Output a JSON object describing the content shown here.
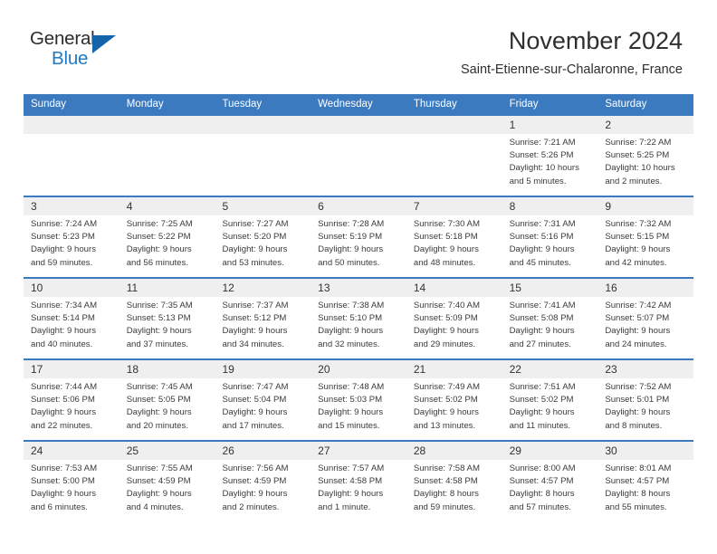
{
  "brand": {
    "name_part1": "General",
    "name_part2": "Blue",
    "logo_icon": "triangle-logo-icon",
    "accent_color": "#1f7ac4",
    "header_color": "#3c7ac0"
  },
  "header": {
    "title": "November 2024",
    "subtitle": "Saint-Etienne-sur-Chalaronne, France"
  },
  "calendar": {
    "weekdays": [
      "Sunday",
      "Monday",
      "Tuesday",
      "Wednesday",
      "Thursday",
      "Friday",
      "Saturday"
    ],
    "weeks": [
      [
        {
          "day": "",
          "lines": []
        },
        {
          "day": "",
          "lines": []
        },
        {
          "day": "",
          "lines": []
        },
        {
          "day": "",
          "lines": []
        },
        {
          "day": "",
          "lines": []
        },
        {
          "day": "1",
          "lines": [
            "Sunrise: 7:21 AM",
            "Sunset: 5:26 PM",
            "Daylight: 10 hours",
            "and 5 minutes."
          ]
        },
        {
          "day": "2",
          "lines": [
            "Sunrise: 7:22 AM",
            "Sunset: 5:25 PM",
            "Daylight: 10 hours",
            "and 2 minutes."
          ]
        }
      ],
      [
        {
          "day": "3",
          "lines": [
            "Sunrise: 7:24 AM",
            "Sunset: 5:23 PM",
            "Daylight: 9 hours",
            "and 59 minutes."
          ]
        },
        {
          "day": "4",
          "lines": [
            "Sunrise: 7:25 AM",
            "Sunset: 5:22 PM",
            "Daylight: 9 hours",
            "and 56 minutes."
          ]
        },
        {
          "day": "5",
          "lines": [
            "Sunrise: 7:27 AM",
            "Sunset: 5:20 PM",
            "Daylight: 9 hours",
            "and 53 minutes."
          ]
        },
        {
          "day": "6",
          "lines": [
            "Sunrise: 7:28 AM",
            "Sunset: 5:19 PM",
            "Daylight: 9 hours",
            "and 50 minutes."
          ]
        },
        {
          "day": "7",
          "lines": [
            "Sunrise: 7:30 AM",
            "Sunset: 5:18 PM",
            "Daylight: 9 hours",
            "and 48 minutes."
          ]
        },
        {
          "day": "8",
          "lines": [
            "Sunrise: 7:31 AM",
            "Sunset: 5:16 PM",
            "Daylight: 9 hours",
            "and 45 minutes."
          ]
        },
        {
          "day": "9",
          "lines": [
            "Sunrise: 7:32 AM",
            "Sunset: 5:15 PM",
            "Daylight: 9 hours",
            "and 42 minutes."
          ]
        }
      ],
      [
        {
          "day": "10",
          "lines": [
            "Sunrise: 7:34 AM",
            "Sunset: 5:14 PM",
            "Daylight: 9 hours",
            "and 40 minutes."
          ]
        },
        {
          "day": "11",
          "lines": [
            "Sunrise: 7:35 AM",
            "Sunset: 5:13 PM",
            "Daylight: 9 hours",
            "and 37 minutes."
          ]
        },
        {
          "day": "12",
          "lines": [
            "Sunrise: 7:37 AM",
            "Sunset: 5:12 PM",
            "Daylight: 9 hours",
            "and 34 minutes."
          ]
        },
        {
          "day": "13",
          "lines": [
            "Sunrise: 7:38 AM",
            "Sunset: 5:10 PM",
            "Daylight: 9 hours",
            "and 32 minutes."
          ]
        },
        {
          "day": "14",
          "lines": [
            "Sunrise: 7:40 AM",
            "Sunset: 5:09 PM",
            "Daylight: 9 hours",
            "and 29 minutes."
          ]
        },
        {
          "day": "15",
          "lines": [
            "Sunrise: 7:41 AM",
            "Sunset: 5:08 PM",
            "Daylight: 9 hours",
            "and 27 minutes."
          ]
        },
        {
          "day": "16",
          "lines": [
            "Sunrise: 7:42 AM",
            "Sunset: 5:07 PM",
            "Daylight: 9 hours",
            "and 24 minutes."
          ]
        }
      ],
      [
        {
          "day": "17",
          "lines": [
            "Sunrise: 7:44 AM",
            "Sunset: 5:06 PM",
            "Daylight: 9 hours",
            "and 22 minutes."
          ]
        },
        {
          "day": "18",
          "lines": [
            "Sunrise: 7:45 AM",
            "Sunset: 5:05 PM",
            "Daylight: 9 hours",
            "and 20 minutes."
          ]
        },
        {
          "day": "19",
          "lines": [
            "Sunrise: 7:47 AM",
            "Sunset: 5:04 PM",
            "Daylight: 9 hours",
            "and 17 minutes."
          ]
        },
        {
          "day": "20",
          "lines": [
            "Sunrise: 7:48 AM",
            "Sunset: 5:03 PM",
            "Daylight: 9 hours",
            "and 15 minutes."
          ]
        },
        {
          "day": "21",
          "lines": [
            "Sunrise: 7:49 AM",
            "Sunset: 5:02 PM",
            "Daylight: 9 hours",
            "and 13 minutes."
          ]
        },
        {
          "day": "22",
          "lines": [
            "Sunrise: 7:51 AM",
            "Sunset: 5:02 PM",
            "Daylight: 9 hours",
            "and 11 minutes."
          ]
        },
        {
          "day": "23",
          "lines": [
            "Sunrise: 7:52 AM",
            "Sunset: 5:01 PM",
            "Daylight: 9 hours",
            "and 8 minutes."
          ]
        }
      ],
      [
        {
          "day": "24",
          "lines": [
            "Sunrise: 7:53 AM",
            "Sunset: 5:00 PM",
            "Daylight: 9 hours",
            "and 6 minutes."
          ]
        },
        {
          "day": "25",
          "lines": [
            "Sunrise: 7:55 AM",
            "Sunset: 4:59 PM",
            "Daylight: 9 hours",
            "and 4 minutes."
          ]
        },
        {
          "day": "26",
          "lines": [
            "Sunrise: 7:56 AM",
            "Sunset: 4:59 PM",
            "Daylight: 9 hours",
            "and 2 minutes."
          ]
        },
        {
          "day": "27",
          "lines": [
            "Sunrise: 7:57 AM",
            "Sunset: 4:58 PM",
            "Daylight: 9 hours",
            "and 1 minute."
          ]
        },
        {
          "day": "28",
          "lines": [
            "Sunrise: 7:58 AM",
            "Sunset: 4:58 PM",
            "Daylight: 8 hours",
            "and 59 minutes."
          ]
        },
        {
          "day": "29",
          "lines": [
            "Sunrise: 8:00 AM",
            "Sunset: 4:57 PM",
            "Daylight: 8 hours",
            "and 57 minutes."
          ]
        },
        {
          "day": "30",
          "lines": [
            "Sunrise: 8:01 AM",
            "Sunset: 4:57 PM",
            "Daylight: 8 hours",
            "and 55 minutes."
          ]
        }
      ]
    ]
  }
}
